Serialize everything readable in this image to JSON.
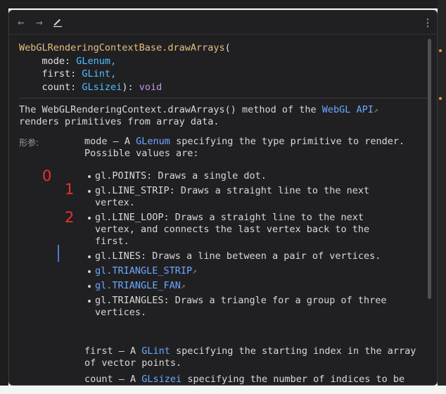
{
  "toolbar": {
    "back_icon": "arrow-left-icon",
    "forward_icon": "arrow-right-icon",
    "edit_icon": "pencil-icon",
    "more_icon": "more-vertical-icon"
  },
  "signature": {
    "name": "WebGLRenderingContextBase.drawArrays",
    "open": "(",
    "params": [
      {
        "name": "mode",
        "type": "GLenum",
        "sep": ","
      },
      {
        "name": "first",
        "type": "GLint",
        "sep": ","
      },
      {
        "name": "count",
        "type": "GLsizei",
        "sep": "):"
      }
    ],
    "return_type": "void"
  },
  "description": {
    "part1": "The WebGLRenderingContext.drawArrays() method of the ",
    "link": "WebGL API",
    "part2": "renders primitives from array data."
  },
  "params_label": "形参:",
  "mode": {
    "lead": "mode — A ",
    "type": "GLenum",
    "rest": " specifying the type primitive to render.",
    "line2": "Possible values are:"
  },
  "values": [
    {
      "lines": [
        "gl.POINTS: Draws a single dot."
      ]
    },
    {
      "lines": [
        "gl.LINE_STRIP: Draws a straight line to the next",
        "vertex."
      ]
    },
    {
      "lines": [
        "gl.LINE_LOOP: Draws a straight line to the next",
        "vertex, and connects the last vertex back to the",
        "first."
      ]
    },
    {
      "lines": [
        "gl.LINES: Draws a line between a pair of vertices."
      ]
    },
    {
      "link": "gl.TRIANGLE_STRIP"
    },
    {
      "link": "gl.TRIANGLE_FAN"
    },
    {
      "lines": [
        "gl.TRIANGLES: Draws a triangle for a group of three",
        "vertices."
      ]
    }
  ],
  "first": {
    "lead": "first — A ",
    "type": "GLint",
    "rest": " specifying the starting index in the array",
    "line2": "of vector points."
  },
  "count": {
    "lead": "count — A ",
    "type": "GLsizei",
    "rest": " specifying the number of indices to be"
  },
  "annotations": [
    "0",
    "1",
    "2"
  ],
  "colors": {
    "background": "#202023",
    "function": "#e5c07b",
    "type": "#4fc1ff",
    "keyword": "#c792ea",
    "link": "#6ea8ff",
    "annotation": "#e8322a"
  }
}
